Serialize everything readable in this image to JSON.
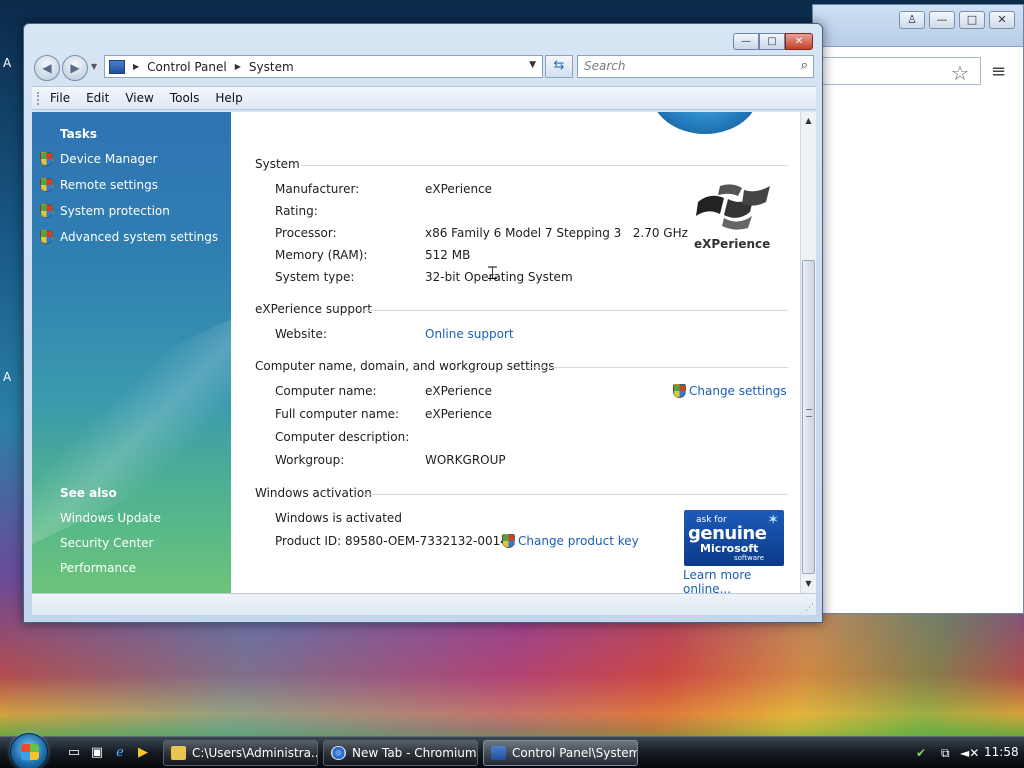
{
  "window": {
    "title_controls": {
      "minimize": "—",
      "maximize": "□",
      "close": "✕"
    },
    "address": {
      "crumbs": [
        "Control Panel",
        "System"
      ]
    },
    "search_placeholder": "Search"
  },
  "menu": [
    "File",
    "Edit",
    "View",
    "Tools",
    "Help"
  ],
  "tasks": {
    "heading": "Tasks",
    "items": [
      "Device Manager",
      "Remote settings",
      "System protection",
      "Advanced system settings"
    ],
    "see_also_heading": "See also",
    "see_also": [
      "Windows Update",
      "Security Center",
      "Performance"
    ]
  },
  "system": {
    "title": "System",
    "rows": [
      {
        "label": "Manufacturer:",
        "value": "eXPerience"
      },
      {
        "label": "Rating:",
        "value": ""
      },
      {
        "label": "Processor:",
        "value": "x86 Family 6 Model 7 Stepping 3   2.70 GHz"
      },
      {
        "label": "Memory (RAM):",
        "value": "512 MB"
      },
      {
        "label": "System type:",
        "value": "32-bit Operating System"
      }
    ],
    "logo_text": "eXPerience"
  },
  "support": {
    "title": "eXPerience support",
    "label": "Website:",
    "link": "Online support"
  },
  "computer": {
    "title": "Computer name, domain, and workgroup settings",
    "rows": [
      {
        "label": "Computer name:",
        "value": "eXPerience"
      },
      {
        "label": "Full computer name:",
        "value": "eXPerience"
      },
      {
        "label": "Computer description:",
        "value": ""
      },
      {
        "label": "Workgroup:",
        "value": "WORKGROUP"
      }
    ],
    "change_link": "Change settings"
  },
  "activation": {
    "title": "Windows activation",
    "status": "Windows is activated",
    "product_id": "Product ID: 89580-OEM-7332132-00141",
    "change_key": "Change product key",
    "learn_more": "Learn more online...",
    "genuine": {
      "line1": "ask for",
      "line2": "genuine",
      "line3": "Microsoft",
      "line4": "software"
    }
  },
  "chrome": {
    "controls": [
      "♙",
      "—",
      "□",
      "✕"
    ]
  },
  "taskbar": {
    "buttons": [
      "C:\\Users\\Administra...",
      "New Tab - Chromium",
      "Control Panel\\System"
    ],
    "clock": "11:58"
  },
  "colors": {
    "link": "#1a5fb4",
    "task_pane_top": "#2f73b3",
    "task_pane_bottom": "#6dc37a"
  }
}
